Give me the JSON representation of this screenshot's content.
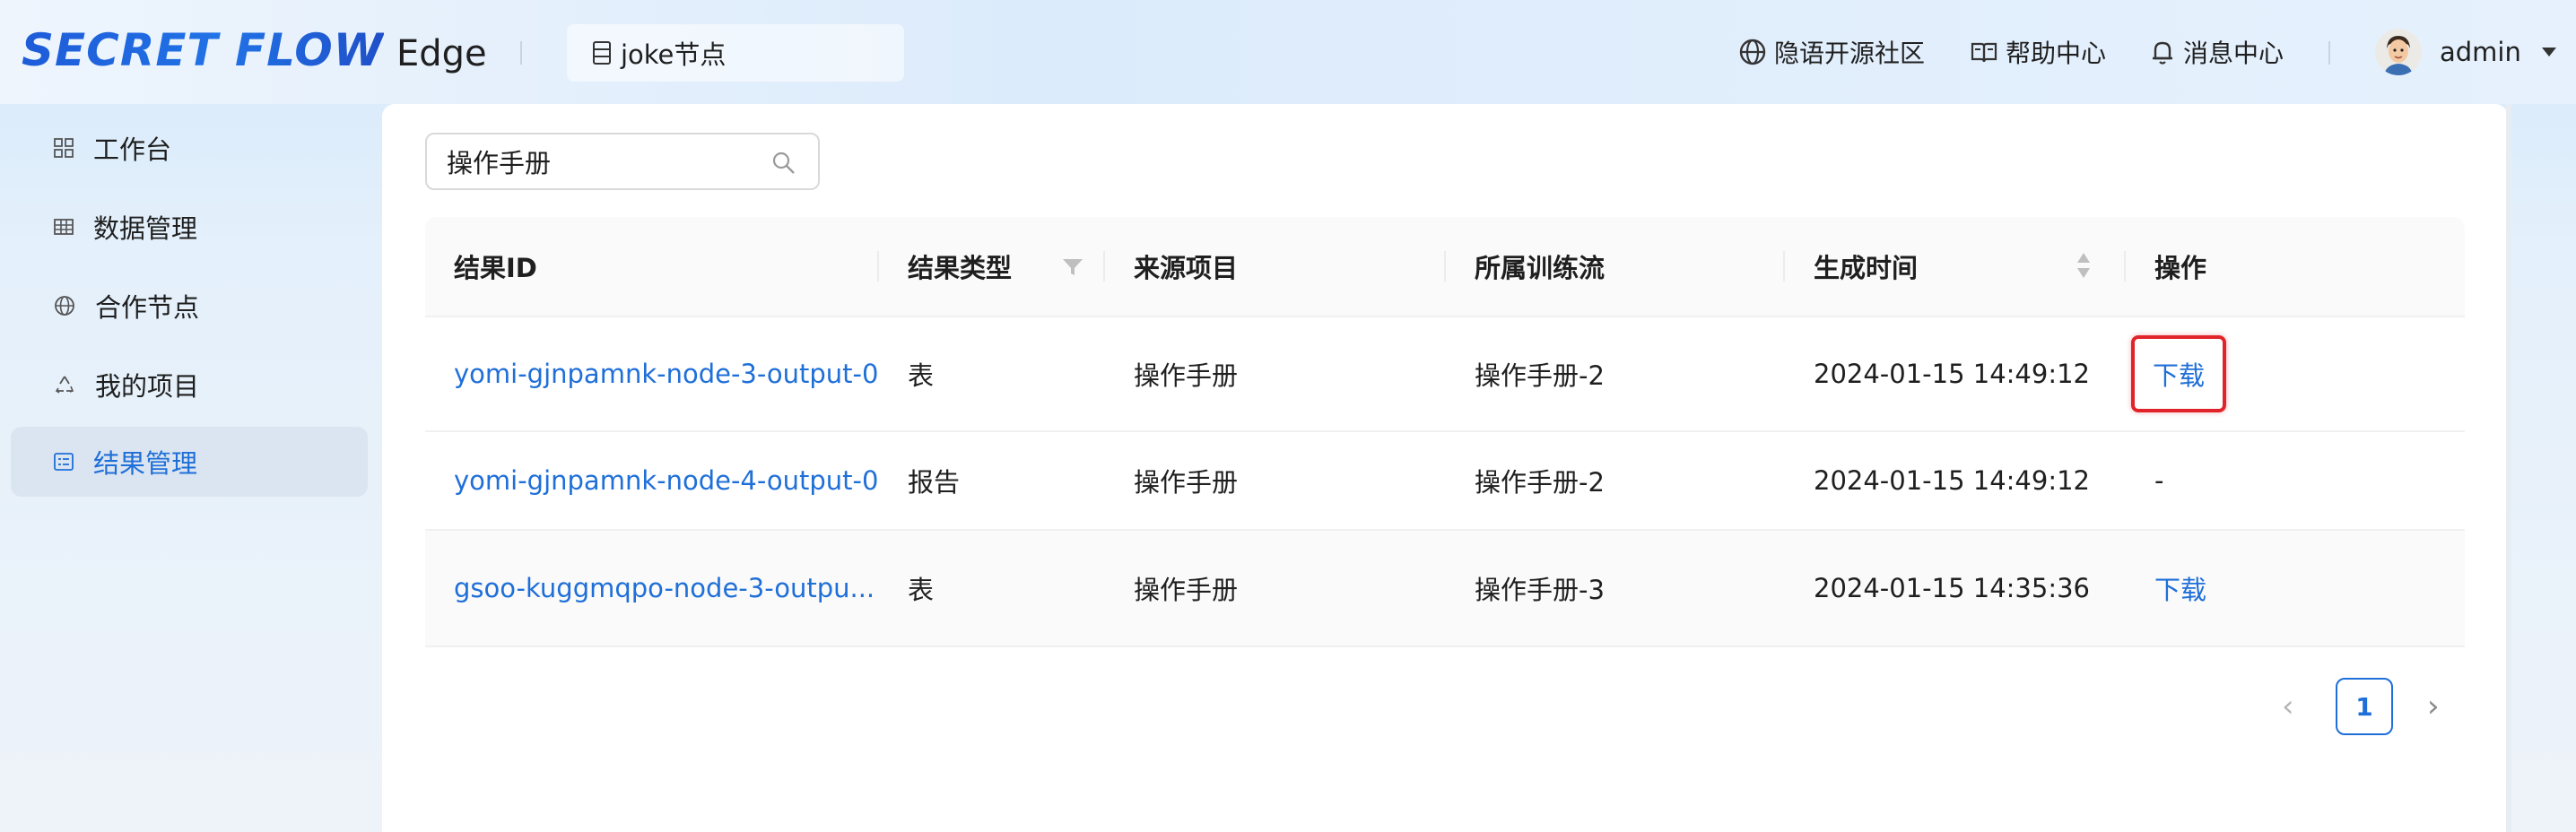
{
  "header": {
    "logo": "SECRET FLOW",
    "app_name": "Edge",
    "node_selector": "joke节点",
    "links": {
      "community": "隐语开源社区",
      "help": "帮助中心",
      "messages": "消息中心"
    },
    "user": "admin"
  },
  "sidebar": {
    "items": [
      {
        "label": "工作台",
        "icon": "dashboard-grid-icon"
      },
      {
        "label": "数据管理",
        "icon": "table-icon"
      },
      {
        "label": "合作节点",
        "icon": "globe-icon"
      },
      {
        "label": "我的项目",
        "icon": "recycle-icon"
      },
      {
        "label": "结果管理",
        "icon": "result-list-icon",
        "active": true
      }
    ]
  },
  "search": {
    "value": "操作手册",
    "placeholder": ""
  },
  "table": {
    "columns": [
      "结果ID",
      "结果类型",
      "来源项目",
      "所属训练流",
      "生成时间",
      "操作"
    ],
    "rows": [
      {
        "id": "yomi-gjnpamnk-node-3-output-0",
        "type": "表",
        "project": "操作手册",
        "flow": "操作手册-2",
        "time": "2024-01-15 14:49:12",
        "action": "下载"
      },
      {
        "id": "yomi-gjnpamnk-node-4-output-0",
        "type": "报告",
        "project": "操作手册",
        "flow": "操作手册-2",
        "time": "2024-01-15 14:49:12",
        "action": "-"
      },
      {
        "id": "gsoo-kuggmqpo-node-3-outpu...",
        "type": "表",
        "project": "操作手册",
        "flow": "操作手册-3",
        "time": "2024-01-15 14:35:36",
        "action": "下载"
      }
    ]
  },
  "pagination": {
    "current": "1",
    "prev": "‹",
    "next": "›"
  },
  "colors": {
    "accent": "#1f6fd8",
    "highlight": "#e0242a"
  }
}
